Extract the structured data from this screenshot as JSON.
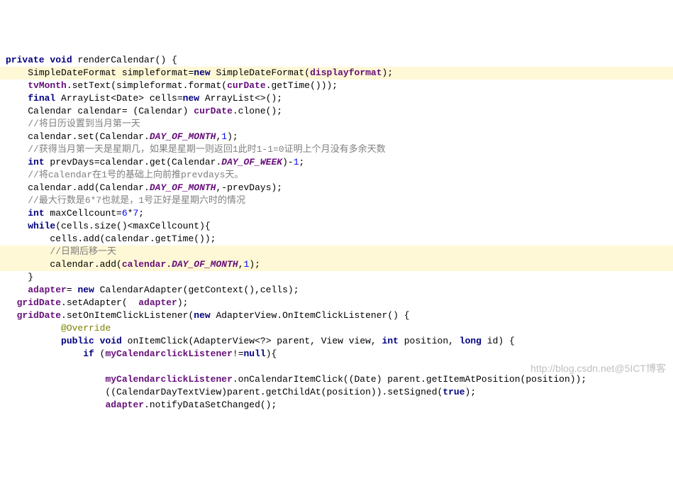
{
  "lines": [
    {
      "indent": 0,
      "segments": [
        {
          "t": "private",
          "c": "kw"
        },
        {
          "t": " "
        },
        {
          "t": "void",
          "c": "kw"
        },
        {
          "t": " renderCalendar() {"
        }
      ]
    },
    {
      "indent": 1,
      "hl": true,
      "segments": [
        {
          "t": "SimpleDateFormat simpleformat="
        },
        {
          "t": "new",
          "c": "kw"
        },
        {
          "t": " SimpleDateFormat("
        },
        {
          "t": "displayformat",
          "c": "field"
        },
        {
          "t": ");"
        }
      ]
    },
    {
      "indent": 1,
      "segments": [
        {
          "t": "tvMonth",
          "c": "field"
        },
        {
          "t": ".setText(simpleformat.format("
        },
        {
          "t": "curDate",
          "c": "field"
        },
        {
          "t": ".getTime()));"
        }
      ]
    },
    {
      "indent": 1,
      "segments": [
        {
          "t": "final",
          "c": "kw"
        },
        {
          "t": " ArrayList<Date> cells="
        },
        {
          "t": "new",
          "c": "kw"
        },
        {
          "t": " ArrayList<>();"
        }
      ]
    },
    {
      "indent": 1,
      "segments": [
        {
          "t": "Calendar calendar= (Calendar) "
        },
        {
          "t": "curDate",
          "c": "field"
        },
        {
          "t": ".clone();"
        }
      ]
    },
    {
      "indent": 1,
      "segments": [
        {
          "t": "//将日历设置到当月第一天",
          "c": "comment"
        }
      ]
    },
    {
      "indent": 1,
      "segments": [
        {
          "t": "calendar.set(Calendar."
        },
        {
          "t": "DAY_OF_MONTH",
          "c": "static-field"
        },
        {
          "t": ","
        },
        {
          "t": "1",
          "c": "num"
        },
        {
          "t": ");"
        }
      ]
    },
    {
      "indent": 1,
      "segments": [
        {
          "t": "//获得当月第一天是星期几，如果是星期一则返回1此时1-1=0证明上个月没有多余天数",
          "c": "comment"
        }
      ]
    },
    {
      "indent": 1,
      "segments": [
        {
          "t": "int",
          "c": "kw"
        },
        {
          "t": " prevDays=calendar.get(Calendar."
        },
        {
          "t": "DAY_OF_WEEK",
          "c": "static-field"
        },
        {
          "t": ")-"
        },
        {
          "t": "1",
          "c": "num"
        },
        {
          "t": ";"
        }
      ]
    },
    {
      "indent": 1,
      "segments": [
        {
          "t": "//将calendar在1号的基础上向前推prevdays天。",
          "c": "comment"
        }
      ]
    },
    {
      "indent": 1,
      "segments": [
        {
          "t": "calendar.add(Calendar."
        },
        {
          "t": "DAY_OF_MONTH",
          "c": "static-field"
        },
        {
          "t": ",-prevDays);"
        }
      ]
    },
    {
      "indent": 1,
      "segments": [
        {
          "t": "//最大行数是6*7也就是，1号正好是星期六时的情况",
          "c": "comment"
        }
      ]
    },
    {
      "indent": 1,
      "segments": [
        {
          "t": "int",
          "c": "kw"
        },
        {
          "t": " maxCellcount="
        },
        {
          "t": "6",
          "c": "num"
        },
        {
          "t": "*"
        },
        {
          "t": "7",
          "c": "num"
        },
        {
          "t": ";"
        }
      ]
    },
    {
      "indent": 1,
      "segments": [
        {
          "t": "while",
          "c": "kw"
        },
        {
          "t": "(cells.size()<maxCellcount){"
        }
      ]
    },
    {
      "indent": 2,
      "segments": [
        {
          "t": "cells.add(calendar.getTime());"
        }
      ]
    },
    {
      "indent": 2,
      "hl": true,
      "segments": [
        {
          "t": "//日期后移一天",
          "c": "comment"
        }
      ]
    },
    {
      "indent": 2,
      "hl": true,
      "segments": [
        {
          "t": "calendar.add("
        },
        {
          "t": "calendar",
          "c": "field",
          "hl": true
        },
        {
          "t": ".",
          "hl": true
        },
        {
          "t": "DAY_OF_MONTH",
          "c": "static-field",
          "hl": true
        },
        {
          "t": ","
        },
        {
          "t": "1",
          "c": "num"
        },
        {
          "t": ");"
        }
      ]
    },
    {
      "indent": 1,
      "segments": [
        {
          "t": "}"
        }
      ]
    },
    {
      "indent": 1,
      "segments": [
        {
          "t": "adapter",
          "c": "field"
        },
        {
          "t": "= "
        },
        {
          "t": "new",
          "c": "kw"
        },
        {
          "t": " CalendarAdapter(getContext(),cells);"
        }
      ]
    },
    {
      "indent": 0,
      "segments": [
        {
          "t": "  "
        },
        {
          "t": "gridDate",
          "c": "field"
        },
        {
          "t": ".setAdapter(  "
        },
        {
          "t": "adapter",
          "c": "field"
        },
        {
          "t": ");"
        }
      ]
    },
    {
      "indent": 0,
      "segments": [
        {
          "t": "  "
        },
        {
          "t": "gridDate",
          "c": "field"
        },
        {
          "t": ".setOnItemClickListener("
        },
        {
          "t": "new",
          "c": "kw"
        },
        {
          "t": " AdapterView.OnItemClickListener() {"
        }
      ]
    },
    {
      "indent": 2,
      "segments": [
        {
          "t": "  "
        },
        {
          "t": "@Override",
          "c": "anno"
        }
      ]
    },
    {
      "indent": 2,
      "segments": [
        {
          "t": "  "
        },
        {
          "t": "public",
          "c": "kw"
        },
        {
          "t": " "
        },
        {
          "t": "void",
          "c": "kw"
        },
        {
          "t": " onItemClick(AdapterView<?> parent, View view, "
        },
        {
          "t": "int",
          "c": "kw"
        },
        {
          "t": " position, "
        },
        {
          "t": "long",
          "c": "kw"
        },
        {
          "t": " id) {"
        }
      ]
    },
    {
      "indent": 3,
      "segments": [
        {
          "t": "  "
        },
        {
          "t": "if",
          "c": "kw"
        },
        {
          "t": " ("
        },
        {
          "t": "myCalendarclickListener",
          "c": "field"
        },
        {
          "t": "!="
        },
        {
          "t": "null",
          "c": "kw"
        },
        {
          "t": "){"
        }
      ]
    },
    {
      "indent": 0,
      "segments": [
        {
          "t": " "
        }
      ]
    },
    {
      "indent": 4,
      "segments": [
        {
          "t": "  "
        },
        {
          "t": "myCalendarclickListener",
          "c": "field"
        },
        {
          "t": ".onCalendarItemClick((Date) parent.getItemAtPosition(position));"
        }
      ]
    },
    {
      "indent": 4,
      "segments": [
        {
          "t": "  ((CalendarDayTextView)parent.getChildAt(position)).setSigned("
        },
        {
          "t": "true",
          "c": "kw"
        },
        {
          "t": ");"
        }
      ]
    },
    {
      "indent": 4,
      "segments": [
        {
          "t": "  "
        },
        {
          "t": "adapter",
          "c": "field"
        },
        {
          "t": ".notifyDataSetChanged();"
        }
      ]
    }
  ],
  "watermark": "http://blog.csdn.net@5ICT博客",
  "indentUnit": "    "
}
